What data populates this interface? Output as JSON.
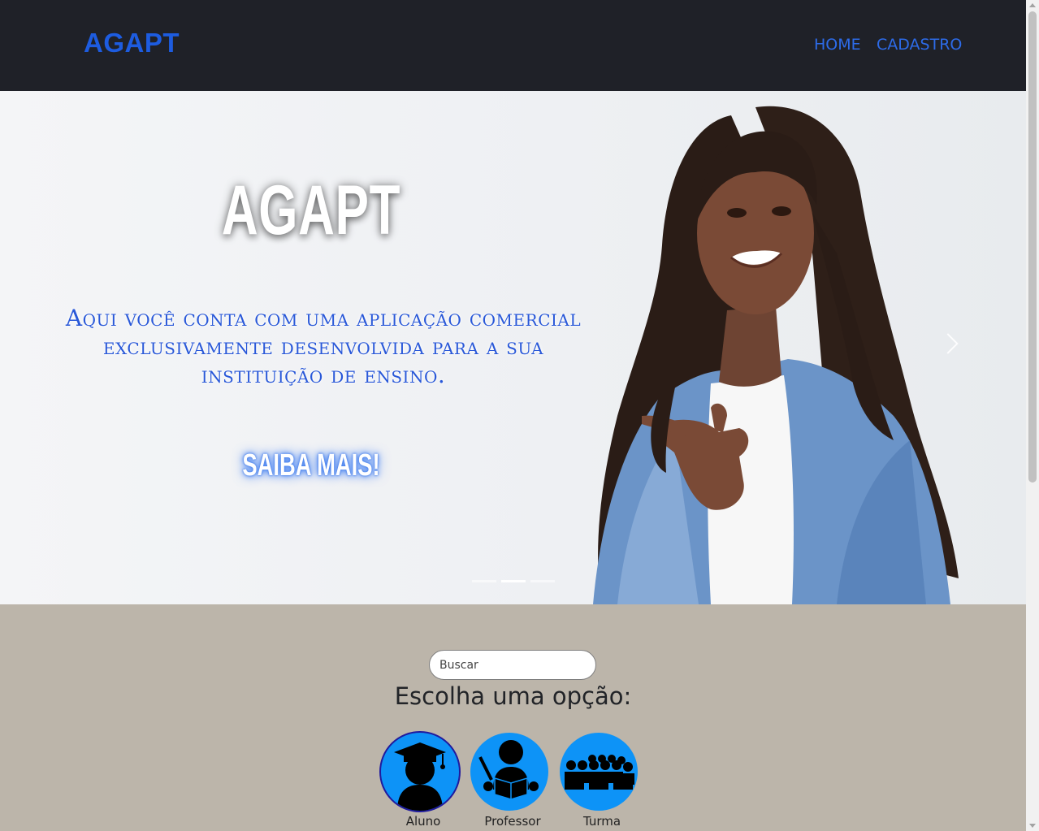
{
  "navbar": {
    "brand": "AGAPT",
    "links": [
      "HOME",
      "CADASTRO"
    ]
  },
  "hero": {
    "title": "AGAPT",
    "subtitle": "Aqui você conta com uma aplicação comercial exclusivamente desenvolvida para a sua instituição de ensino.",
    "cta": "SAIBA MAIS!",
    "slides": 3,
    "active_slide": 2
  },
  "search": {
    "placeholder": "Buscar"
  },
  "options": {
    "heading": "Escolha uma opção:",
    "items": [
      {
        "label": "Aluno",
        "icon": "student-graduate-icon"
      },
      {
        "label": "Professor",
        "icon": "teacher-icon"
      },
      {
        "label": "Turma",
        "icon": "classroom-icon"
      }
    ]
  },
  "colors": {
    "navbar_bg": "#1f2128",
    "brand": "#1d5ce0",
    "option_circle": "#0d93f7",
    "section_bg": "#bcb5aa"
  }
}
